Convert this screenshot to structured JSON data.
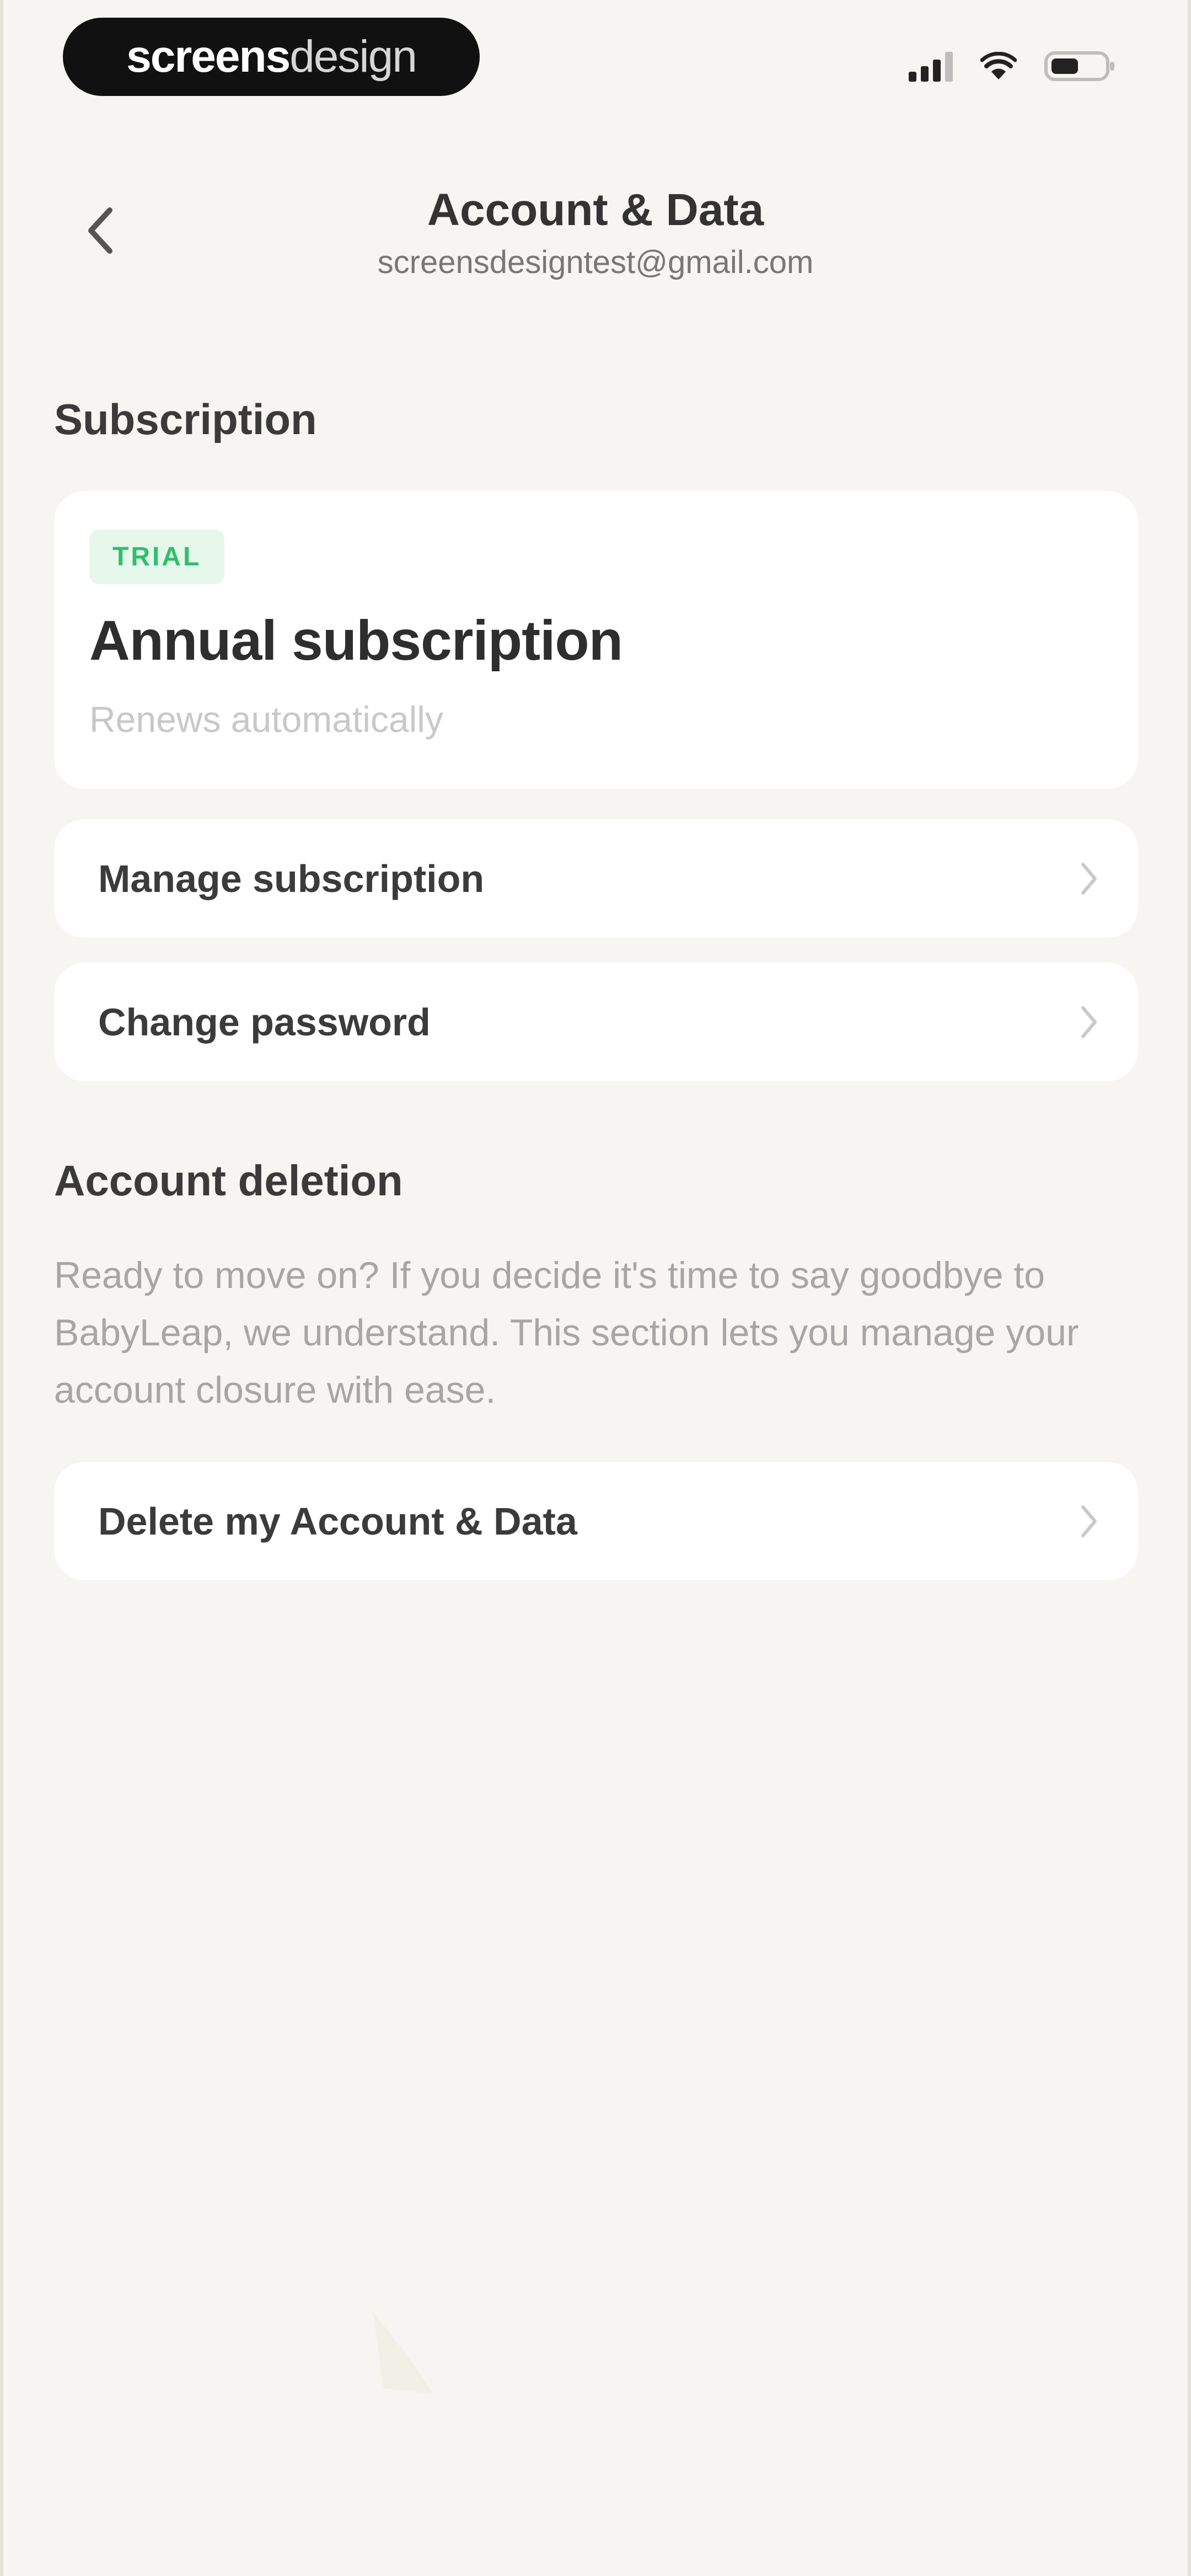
{
  "status_bar": {
    "brand_strong": "screens",
    "brand_light": "design"
  },
  "header": {
    "title": "Account & Data",
    "subtitle": "screensdesigntest@gmail.com"
  },
  "subscription": {
    "heading": "Subscription",
    "badge": "TRIAL",
    "plan_title": "Annual subscription",
    "renewal_text": "Renews automatically"
  },
  "menu": {
    "manage_subscription": "Manage subscription",
    "change_password": "Change password"
  },
  "account_deletion": {
    "heading": "Account deletion",
    "description": "Ready to move on? If you decide it's time to say goodbye to BabyLeap, we understand. This section lets you manage your account closure with ease.",
    "delete_button": "Delete my Account & Data"
  },
  "colors": {
    "background": "#f7f5f1",
    "card": "#ffffff",
    "trial_green": "#2fbf6a",
    "trial_bg": "#e6f7ec"
  },
  "icons": {
    "back": "chevron-left-icon",
    "row_arrow": "chevron-right-icon",
    "signal": "cellular-signal-icon",
    "wifi": "wifi-icon",
    "battery": "battery-icon"
  }
}
